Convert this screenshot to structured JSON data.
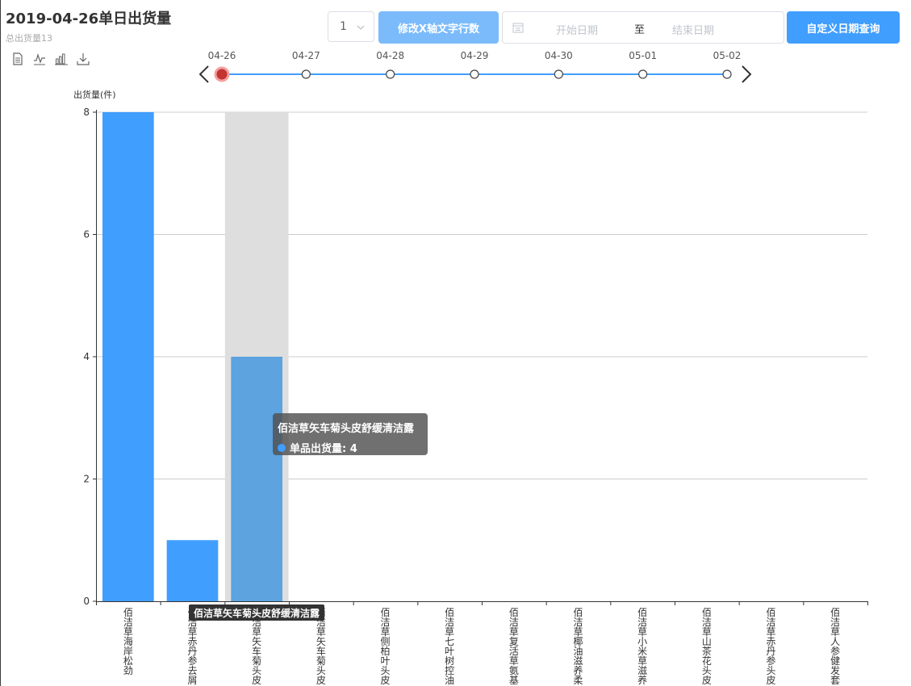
{
  "header": {
    "title": "2019-04-26单日出货量",
    "subtitle": "总出货量13"
  },
  "toolbox": [
    "data-view-icon",
    "line-chart-icon",
    "bar-chart-icon",
    "download-icon"
  ],
  "controls": {
    "rows_select_value": "1",
    "x_label_button": "修改X轴文字行数",
    "start_placeholder": "开始日期",
    "range_separator": "至",
    "end_placeholder": "结束日期",
    "query_button": "自定义日期查询"
  },
  "timeline": {
    "dates": [
      "04-26",
      "04-27",
      "04-28",
      "04-29",
      "04-30",
      "05-01",
      "05-02"
    ],
    "current_index": 0
  },
  "tooltip": {
    "title": "佰洁草矢车菊头皮舒缓清洁露",
    "label": "单品出货量: 4"
  },
  "xlabel_tip": "佰洁草矢车菊头皮舒缓清洁露",
  "colors": {
    "bar": "#409eff",
    "bar_highlight": "#5ca3e0",
    "axis_pointer": "#dedede",
    "timeline_line": "#409eff",
    "timeline_current": "#c23531"
  },
  "chart_data": {
    "type": "bar",
    "ylabel": "出货量(件)",
    "ylim": [
      0,
      8
    ],
    "yticks": [
      0,
      2,
      4,
      6,
      8
    ],
    "categories": [
      "佰洁草海岸松劲",
      "佰洁草赤丹参去屑",
      "佰洁草矢车菊头皮",
      "佰洁草矢车菊头皮",
      "佰洁草侧柏叶头皮",
      "佰洁草七叶树控油",
      "佰洁草复活草氨基",
      "佰洁草椰油滋养柔",
      "佰洁草小米草滋养",
      "佰洁草山茶花头皮",
      "佰洁草赤丹参头皮",
      "佰洁草人参健发套"
    ],
    "series": [
      {
        "name": "单品出货量",
        "values": [
          8,
          1,
          4,
          0,
          0,
          0,
          0,
          0,
          0,
          0,
          0,
          0
        ]
      }
    ],
    "highlight_index": 2,
    "grid": true
  }
}
